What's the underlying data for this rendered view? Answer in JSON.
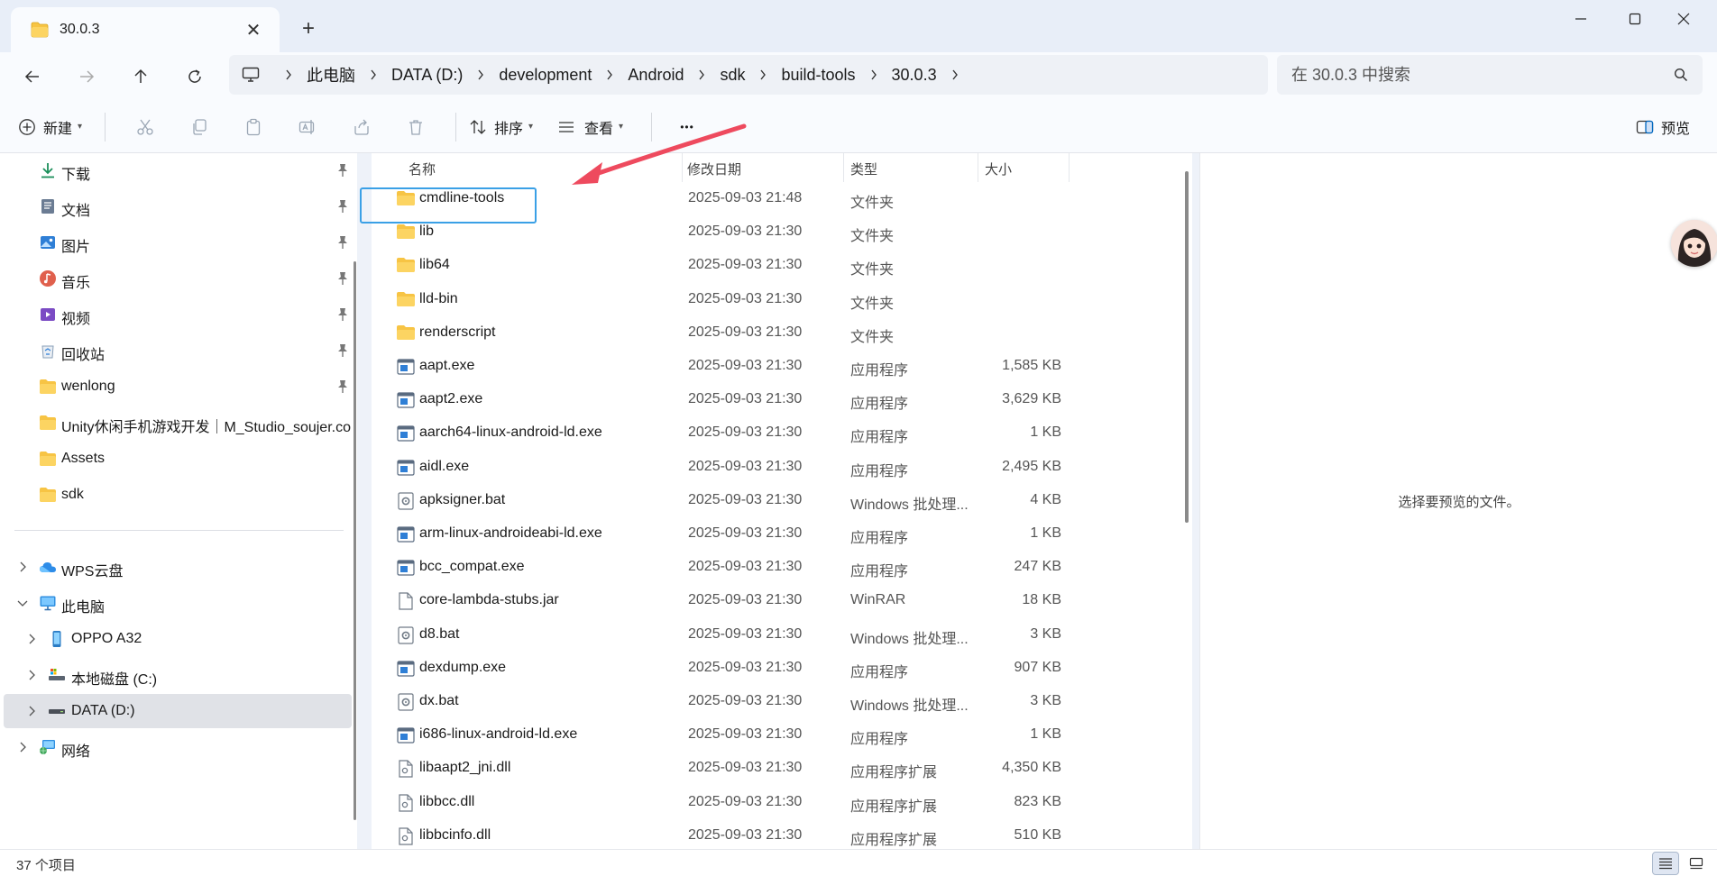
{
  "window": {
    "tab_title": "30.0.3",
    "tab_close_glyph": "✕",
    "new_tab_glyph": "+"
  },
  "address": {
    "breadcrumb": [
      "此电脑",
      "DATA (D:)",
      "development",
      "Android",
      "sdk",
      "build-tools",
      "30.0.3"
    ],
    "search_placeholder": "在 30.0.3 中搜索"
  },
  "toolbar": {
    "new_label": "新建",
    "sort_label": "排序",
    "view_label": "查看",
    "more_glyph": "•••",
    "preview_label": "预览"
  },
  "sidebar": {
    "quick_access": [
      {
        "label": "下载",
        "icon": "download-icon",
        "pinned": true
      },
      {
        "label": "文档",
        "icon": "documents-icon",
        "pinned": true
      },
      {
        "label": "图片",
        "icon": "pictures-icon",
        "pinned": true
      },
      {
        "label": "音乐",
        "icon": "music-icon",
        "pinned": true
      },
      {
        "label": "视频",
        "icon": "videos-icon",
        "pinned": true
      },
      {
        "label": "回收站",
        "icon": "recycle-bin-icon",
        "pinned": true
      },
      {
        "label": "wenlong",
        "icon": "folder-icon",
        "pinned": true
      },
      {
        "label": "Unity休闲手机游戏开发｜M_Studio_soujer.com",
        "icon": "folder-icon",
        "pinned": false
      },
      {
        "label": "Assets",
        "icon": "folder-icon",
        "pinned": false
      },
      {
        "label": "sdk",
        "icon": "folder-icon",
        "pinned": false
      }
    ],
    "tree": [
      {
        "label": "WPS云盘",
        "icon": "cloud-icon",
        "expanded": false
      },
      {
        "label": "此电脑",
        "icon": "computer-icon",
        "expanded": true
      },
      {
        "label": "OPPO A32",
        "icon": "phone-icon",
        "expanded": false
      },
      {
        "label": "本地磁盘 (C:)",
        "icon": "drive-c-icon",
        "expanded": false
      },
      {
        "label": "DATA (D:)",
        "icon": "drive-d-icon",
        "expanded": false,
        "selected": true
      },
      {
        "label": "网络",
        "icon": "network-icon",
        "expanded": false
      }
    ]
  },
  "filelist": {
    "columns": [
      "名称",
      "修改日期",
      "类型",
      "大小"
    ],
    "rows": [
      {
        "name": "cmdline-tools",
        "date": "2025-09-03 21:48",
        "type": "文件夹",
        "size": "",
        "icon": "folder"
      },
      {
        "name": "lib",
        "date": "2025-09-03 21:30",
        "type": "文件夹",
        "size": "",
        "icon": "folder"
      },
      {
        "name": "lib64",
        "date": "2025-09-03 21:30",
        "type": "文件夹",
        "size": "",
        "icon": "folder"
      },
      {
        "name": "lld-bin",
        "date": "2025-09-03 21:30",
        "type": "文件夹",
        "size": "",
        "icon": "folder"
      },
      {
        "name": "renderscript",
        "date": "2025-09-03 21:30",
        "type": "文件夹",
        "size": "",
        "icon": "folder"
      },
      {
        "name": "aapt.exe",
        "date": "2025-09-03 21:30",
        "type": "应用程序",
        "size": "1,585 KB",
        "icon": "exe"
      },
      {
        "name": "aapt2.exe",
        "date": "2025-09-03 21:30",
        "type": "应用程序",
        "size": "3,629 KB",
        "icon": "exe"
      },
      {
        "name": "aarch64-linux-android-ld.exe",
        "date": "2025-09-03 21:30",
        "type": "应用程序",
        "size": "1 KB",
        "icon": "exe"
      },
      {
        "name": "aidl.exe",
        "date": "2025-09-03 21:30",
        "type": "应用程序",
        "size": "2,495 KB",
        "icon": "exe"
      },
      {
        "name": "apksigner.bat",
        "date": "2025-09-03 21:30",
        "type": "Windows 批处理...",
        "size": "4 KB",
        "icon": "bat"
      },
      {
        "name": "arm-linux-androideabi-ld.exe",
        "date": "2025-09-03 21:30",
        "type": "应用程序",
        "size": "1 KB",
        "icon": "exe"
      },
      {
        "name": "bcc_compat.exe",
        "date": "2025-09-03 21:30",
        "type": "应用程序",
        "size": "247 KB",
        "icon": "exe"
      },
      {
        "name": "core-lambda-stubs.jar",
        "date": "2025-09-03 21:30",
        "type": "WinRAR",
        "size": "18 KB",
        "icon": "file"
      },
      {
        "name": "d8.bat",
        "date": "2025-09-03 21:30",
        "type": "Windows 批处理...",
        "size": "3 KB",
        "icon": "bat"
      },
      {
        "name": "dexdump.exe",
        "date": "2025-09-03 21:30",
        "type": "应用程序",
        "size": "907 KB",
        "icon": "exe"
      },
      {
        "name": "dx.bat",
        "date": "2025-09-03 21:30",
        "type": "Windows 批处理...",
        "size": "3 KB",
        "icon": "bat"
      },
      {
        "name": "i686-linux-android-ld.exe",
        "date": "2025-09-03 21:30",
        "type": "应用程序",
        "size": "1 KB",
        "icon": "exe"
      },
      {
        "name": "libaapt2_jni.dll",
        "date": "2025-09-03 21:30",
        "type": "应用程序扩展",
        "size": "4,350 KB",
        "icon": "dll"
      },
      {
        "name": "libbcc.dll",
        "date": "2025-09-03 21:30",
        "type": "应用程序扩展",
        "size": "823 KB",
        "icon": "dll"
      },
      {
        "name": "libbcinfo.dll",
        "date": "2025-09-03 21:30",
        "type": "应用程序扩展",
        "size": "510 KB",
        "icon": "dll"
      }
    ]
  },
  "preview": {
    "empty_text": "选择要预览的文件。"
  },
  "status": {
    "item_count": "37 个项目"
  },
  "colors": {
    "accent": "#0067c0",
    "folder": "#f7c444",
    "highlight_box": "#3aa0e6",
    "arrow": "#ee4a5e"
  }
}
